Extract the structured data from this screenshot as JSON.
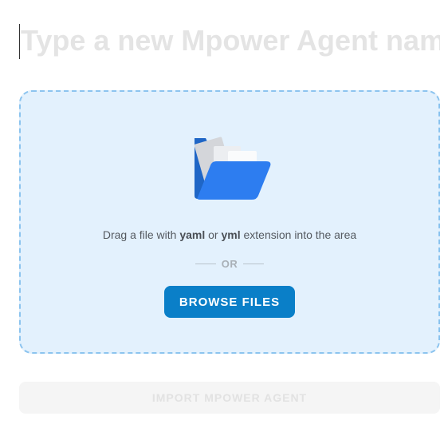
{
  "agent_name": {
    "value": "",
    "placeholder": "Type a new Mpower Agent name"
  },
  "dropzone": {
    "icon": "folder-icon",
    "text_prefix": "Drag a file with ",
    "ext_yaml": "yaml",
    "text_or": " or ",
    "ext_yml": "yml",
    "text_suffix": " extension into the area",
    "separator_label": "OR",
    "browse_label": "BROWSE FILES"
  },
  "footer": {
    "import_label": "IMPORT MPOWER AGENT",
    "import_enabled": false
  },
  "colors": {
    "accent": "#0a7fc8",
    "dropzone_background": "#e3f1fd",
    "dropzone_border": "#8cc4ef",
    "folder_blue": "#2d7df0"
  }
}
